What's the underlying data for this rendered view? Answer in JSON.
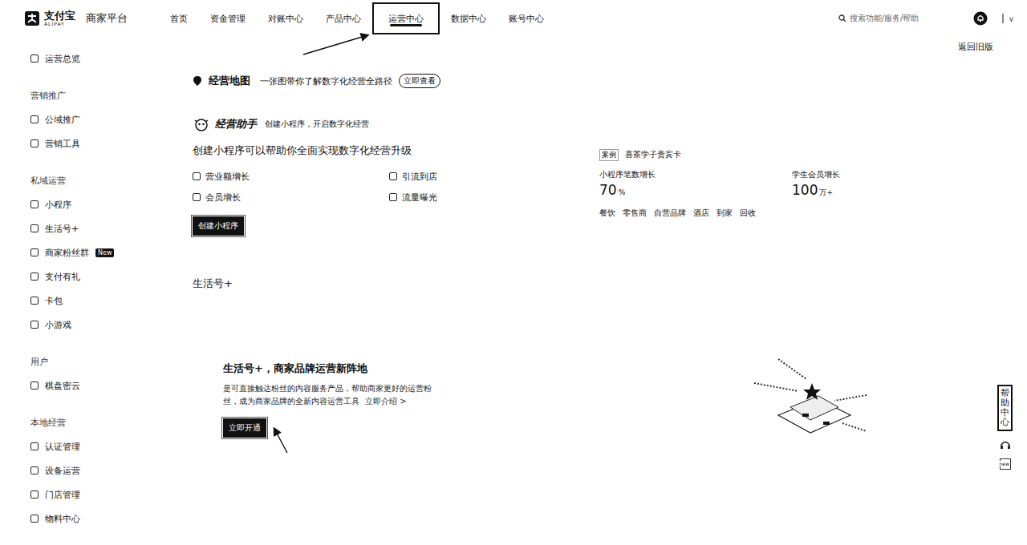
{
  "logo": {
    "brand": "支付宝",
    "brand_en": "ALIPAY",
    "platform": "商家平台"
  },
  "nav": [
    {
      "label": "首页",
      "selected": false
    },
    {
      "label": "资金管理",
      "selected": false
    },
    {
      "label": "对账中心",
      "selected": false
    },
    {
      "label": "产品中心",
      "selected": false
    },
    {
      "label": "运营中心",
      "selected": true
    },
    {
      "label": "数据中心",
      "selected": false
    },
    {
      "label": "账号中心",
      "selected": false
    }
  ],
  "search": {
    "placeholder": "搜索功能/服务/帮助"
  },
  "user_caret": "∨",
  "back_link": "返回旧版",
  "sidebar": {
    "overview": "运营总览",
    "groups": [
      {
        "title": "营销推广",
        "items": [
          {
            "label": "公域推广"
          },
          {
            "label": "营销工具"
          }
        ]
      },
      {
        "title": "私域运营",
        "items": [
          {
            "label": "小程序"
          },
          {
            "label": "生活号+"
          },
          {
            "label": "商家粉丝群",
            "badge": "New"
          },
          {
            "label": "支付有礼"
          },
          {
            "label": "卡包"
          },
          {
            "label": "小游戏"
          }
        ]
      },
      {
        "title": "用户",
        "items": [
          {
            "label": "棋盘密云"
          }
        ]
      },
      {
        "title": "本地经营",
        "items": [
          {
            "label": "认证管理"
          },
          {
            "label": "设备运营"
          },
          {
            "label": "门店管理"
          },
          {
            "label": "物料中心"
          }
        ]
      }
    ]
  },
  "map_banner": {
    "title": "经营地图",
    "desc": "一张图带你了解数字化经营全路径",
    "button": "立即查看"
  },
  "assistant": {
    "title": "经营助手",
    "desc": "创建小程序，开启数字化经营",
    "heading": "创建小程序可以帮助你全面实现数字化经营升级",
    "features": [
      "营业额增长",
      "引流到店",
      "会员增长",
      "流量曝光"
    ],
    "button": "创建小程序",
    "case": {
      "tag": "案例",
      "name": "喜茶学子贵宾卡",
      "stats": [
        {
          "label": "小程序笔数增长",
          "value": "70",
          "unit": "%"
        },
        {
          "label": "学生会员增长",
          "value": "100",
          "unit": "万+"
        }
      ],
      "industries": [
        "餐饮",
        "零售商",
        "自营品牌",
        "酒店",
        "到家",
        "回收"
      ]
    }
  },
  "life": {
    "section_title": "生活号+",
    "card_title": "生活号+，商家品牌运营新阵地",
    "desc": "是可直接触达粉丝的内容服务产品，帮助商家更好的运营粉丝，成为商家品牌的全新内容运营工具",
    "link": "立即介绍 >",
    "button": "立即开通"
  },
  "float_bar": {
    "help": "帮助中心",
    "new_badge": "new"
  }
}
